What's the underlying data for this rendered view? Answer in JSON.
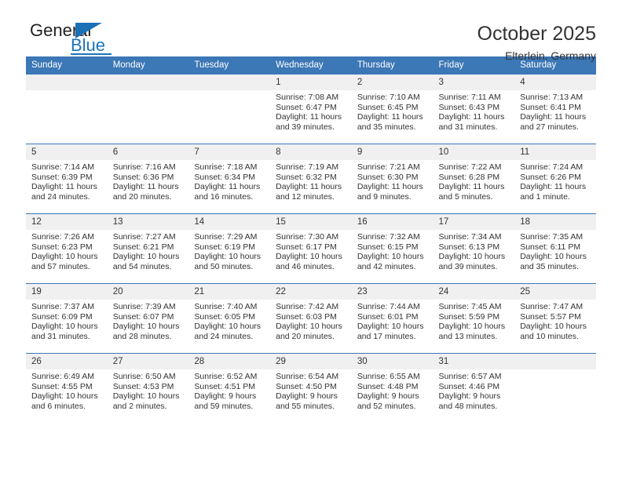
{
  "brand": {
    "word1": "General",
    "word2": "Blue",
    "triangle_color": "#1a6fb5",
    "blue_color": "#1a74bb"
  },
  "header": {
    "month_title": "October 2025",
    "location": "Elterlein, Germany"
  },
  "theme": {
    "header_blue": "#3c77b6",
    "daynum_band": "#f0f0f0",
    "text": "#333333"
  },
  "weekday_headers": [
    "Sunday",
    "Monday",
    "Tuesday",
    "Wednesday",
    "Thursday",
    "Friday",
    "Saturday"
  ],
  "weeks": [
    [
      {
        "day": "",
        "lines": []
      },
      {
        "day": "",
        "lines": []
      },
      {
        "day": "",
        "lines": []
      },
      {
        "day": "1",
        "lines": [
          "Sunrise: 7:08 AM",
          "Sunset: 6:47 PM",
          "Daylight: 11 hours",
          "and 39 minutes."
        ]
      },
      {
        "day": "2",
        "lines": [
          "Sunrise: 7:10 AM",
          "Sunset: 6:45 PM",
          "Daylight: 11 hours",
          "and 35 minutes."
        ]
      },
      {
        "day": "3",
        "lines": [
          "Sunrise: 7:11 AM",
          "Sunset: 6:43 PM",
          "Daylight: 11 hours",
          "and 31 minutes."
        ]
      },
      {
        "day": "4",
        "lines": [
          "Sunrise: 7:13 AM",
          "Sunset: 6:41 PM",
          "Daylight: 11 hours",
          "and 27 minutes."
        ]
      }
    ],
    [
      {
        "day": "5",
        "lines": [
          "Sunrise: 7:14 AM",
          "Sunset: 6:39 PM",
          "Daylight: 11 hours",
          "and 24 minutes."
        ]
      },
      {
        "day": "6",
        "lines": [
          "Sunrise: 7:16 AM",
          "Sunset: 6:36 PM",
          "Daylight: 11 hours",
          "and 20 minutes."
        ]
      },
      {
        "day": "7",
        "lines": [
          "Sunrise: 7:18 AM",
          "Sunset: 6:34 PM",
          "Daylight: 11 hours",
          "and 16 minutes."
        ]
      },
      {
        "day": "8",
        "lines": [
          "Sunrise: 7:19 AM",
          "Sunset: 6:32 PM",
          "Daylight: 11 hours",
          "and 12 minutes."
        ]
      },
      {
        "day": "9",
        "lines": [
          "Sunrise: 7:21 AM",
          "Sunset: 6:30 PM",
          "Daylight: 11 hours",
          "and 9 minutes."
        ]
      },
      {
        "day": "10",
        "lines": [
          "Sunrise: 7:22 AM",
          "Sunset: 6:28 PM",
          "Daylight: 11 hours",
          "and 5 minutes."
        ]
      },
      {
        "day": "11",
        "lines": [
          "Sunrise: 7:24 AM",
          "Sunset: 6:26 PM",
          "Daylight: 11 hours",
          "and 1 minute."
        ]
      }
    ],
    [
      {
        "day": "12",
        "lines": [
          "Sunrise: 7:26 AM",
          "Sunset: 6:23 PM",
          "Daylight: 10 hours",
          "and 57 minutes."
        ]
      },
      {
        "day": "13",
        "lines": [
          "Sunrise: 7:27 AM",
          "Sunset: 6:21 PM",
          "Daylight: 10 hours",
          "and 54 minutes."
        ]
      },
      {
        "day": "14",
        "lines": [
          "Sunrise: 7:29 AM",
          "Sunset: 6:19 PM",
          "Daylight: 10 hours",
          "and 50 minutes."
        ]
      },
      {
        "day": "15",
        "lines": [
          "Sunrise: 7:30 AM",
          "Sunset: 6:17 PM",
          "Daylight: 10 hours",
          "and 46 minutes."
        ]
      },
      {
        "day": "16",
        "lines": [
          "Sunrise: 7:32 AM",
          "Sunset: 6:15 PM",
          "Daylight: 10 hours",
          "and 42 minutes."
        ]
      },
      {
        "day": "17",
        "lines": [
          "Sunrise: 7:34 AM",
          "Sunset: 6:13 PM",
          "Daylight: 10 hours",
          "and 39 minutes."
        ]
      },
      {
        "day": "18",
        "lines": [
          "Sunrise: 7:35 AM",
          "Sunset: 6:11 PM",
          "Daylight: 10 hours",
          "and 35 minutes."
        ]
      }
    ],
    [
      {
        "day": "19",
        "lines": [
          "Sunrise: 7:37 AM",
          "Sunset: 6:09 PM",
          "Daylight: 10 hours",
          "and 31 minutes."
        ]
      },
      {
        "day": "20",
        "lines": [
          "Sunrise: 7:39 AM",
          "Sunset: 6:07 PM",
          "Daylight: 10 hours",
          "and 28 minutes."
        ]
      },
      {
        "day": "21",
        "lines": [
          "Sunrise: 7:40 AM",
          "Sunset: 6:05 PM",
          "Daylight: 10 hours",
          "and 24 minutes."
        ]
      },
      {
        "day": "22",
        "lines": [
          "Sunrise: 7:42 AM",
          "Sunset: 6:03 PM",
          "Daylight: 10 hours",
          "and 20 minutes."
        ]
      },
      {
        "day": "23",
        "lines": [
          "Sunrise: 7:44 AM",
          "Sunset: 6:01 PM",
          "Daylight: 10 hours",
          "and 17 minutes."
        ]
      },
      {
        "day": "24",
        "lines": [
          "Sunrise: 7:45 AM",
          "Sunset: 5:59 PM",
          "Daylight: 10 hours",
          "and 13 minutes."
        ]
      },
      {
        "day": "25",
        "lines": [
          "Sunrise: 7:47 AM",
          "Sunset: 5:57 PM",
          "Daylight: 10 hours",
          "and 10 minutes."
        ]
      }
    ],
    [
      {
        "day": "26",
        "lines": [
          "Sunrise: 6:49 AM",
          "Sunset: 4:55 PM",
          "Daylight: 10 hours",
          "and 6 minutes."
        ]
      },
      {
        "day": "27",
        "lines": [
          "Sunrise: 6:50 AM",
          "Sunset: 4:53 PM",
          "Daylight: 10 hours",
          "and 2 minutes."
        ]
      },
      {
        "day": "28",
        "lines": [
          "Sunrise: 6:52 AM",
          "Sunset: 4:51 PM",
          "Daylight: 9 hours",
          "and 59 minutes."
        ]
      },
      {
        "day": "29",
        "lines": [
          "Sunrise: 6:54 AM",
          "Sunset: 4:50 PM",
          "Daylight: 9 hours",
          "and 55 minutes."
        ]
      },
      {
        "day": "30",
        "lines": [
          "Sunrise: 6:55 AM",
          "Sunset: 4:48 PM",
          "Daylight: 9 hours",
          "and 52 minutes."
        ]
      },
      {
        "day": "31",
        "lines": [
          "Sunrise: 6:57 AM",
          "Sunset: 4:46 PM",
          "Daylight: 9 hours",
          "and 48 minutes."
        ]
      },
      {
        "day": "",
        "lines": []
      }
    ]
  ]
}
